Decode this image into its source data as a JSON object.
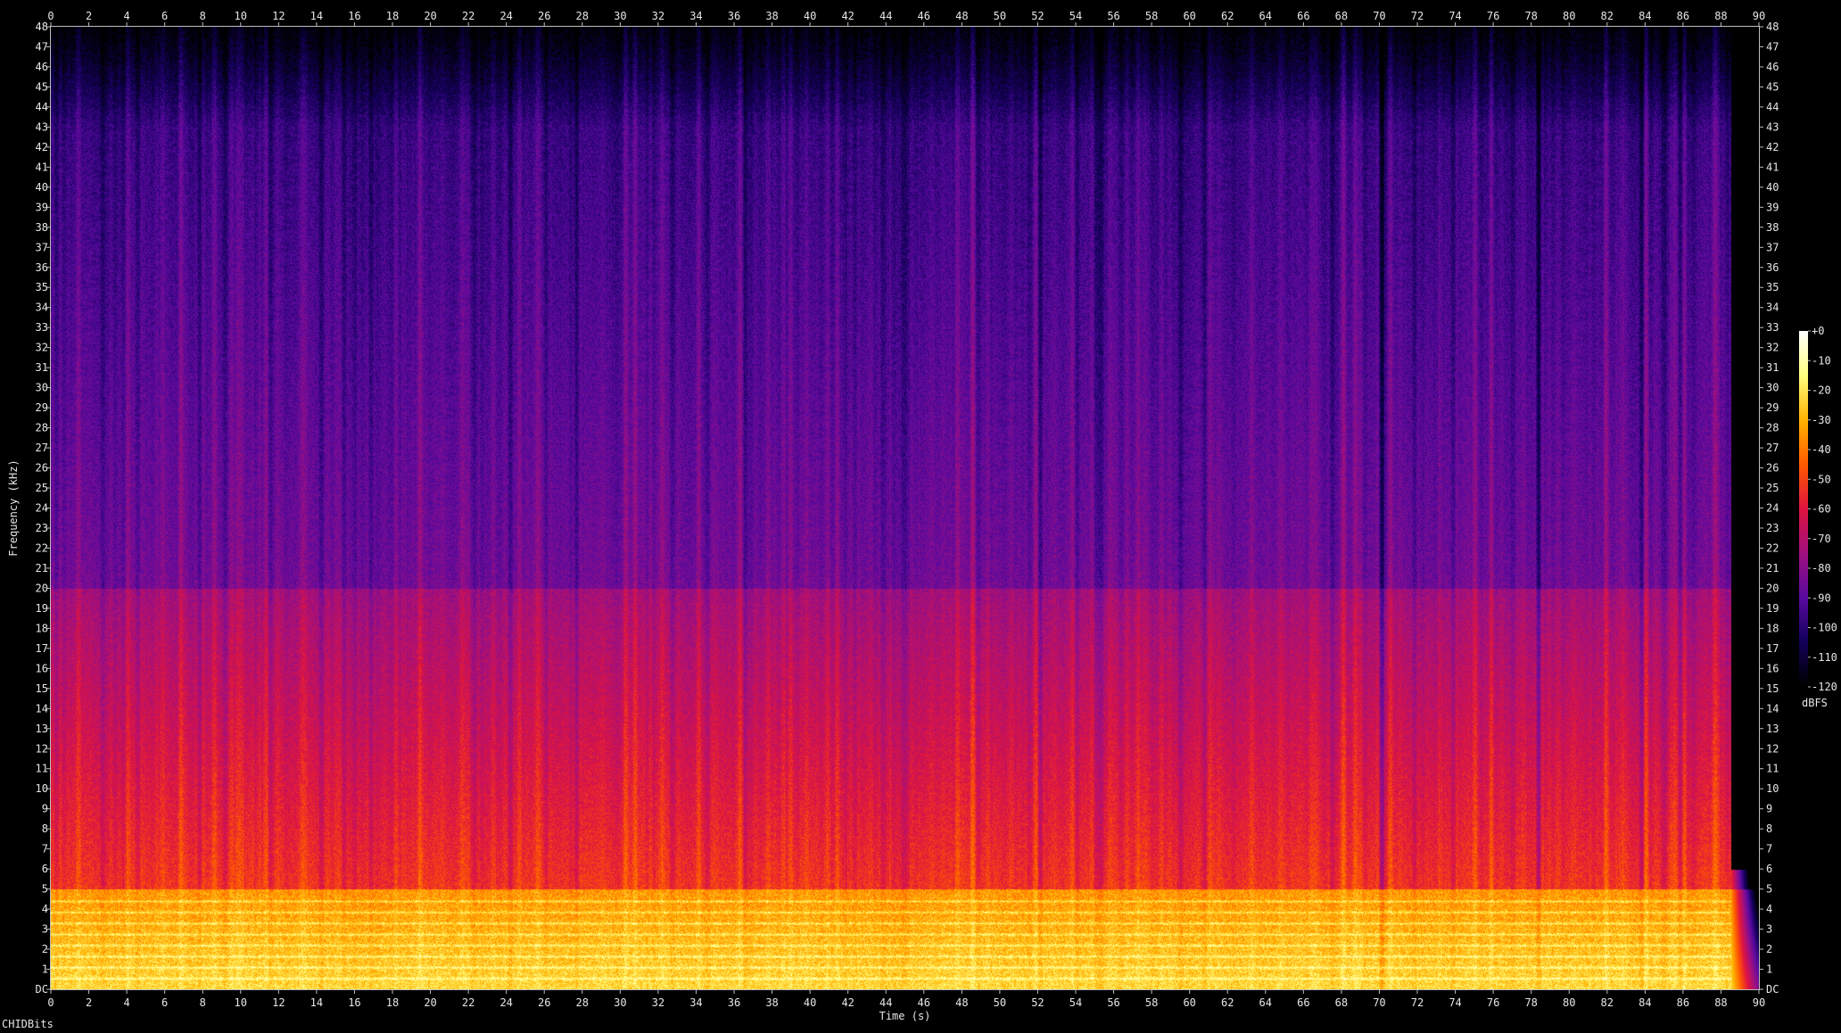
{
  "chart_data": {
    "type": "heatmap",
    "title": "",
    "xlabel": "Time (s)",
    "ylabel": "Frequency (kHz)",
    "xlim": [
      0,
      90
    ],
    "ylim": [
      0,
      48
    ],
    "x_ticks": [
      "0",
      "2",
      "4",
      "6",
      "8",
      "10",
      "12",
      "14",
      "16",
      "18",
      "20",
      "22",
      "24",
      "26",
      "28",
      "30",
      "32",
      "34",
      "36",
      "38",
      "40",
      "42",
      "44",
      "46",
      "48",
      "50",
      "52",
      "54",
      "56",
      "58",
      "60",
      "62",
      "64",
      "66",
      "68",
      "70",
      "72",
      "74",
      "76",
      "78",
      "80",
      "82",
      "84",
      "86",
      "88",
      "90"
    ],
    "y_ticks": [
      "DC",
      "1",
      "2",
      "3",
      "4",
      "5",
      "6",
      "7",
      "8",
      "9",
      "10",
      "11",
      "12",
      "13",
      "14",
      "15",
      "16",
      "17",
      "18",
      "19",
      "20",
      "21",
      "22",
      "23",
      "24",
      "25",
      "26",
      "27",
      "28",
      "29",
      "30",
      "31",
      "32",
      "33",
      "34",
      "35",
      "36",
      "37",
      "38",
      "39",
      "40",
      "41",
      "42",
      "43",
      "44",
      "45",
      "46",
      "47",
      "48"
    ],
    "colorbar": {
      "unit": "dBFS",
      "range": [
        -120,
        0
      ],
      "ticks": [
        "+0",
        "-10",
        "-20",
        "-30",
        "-40",
        "-50",
        "-60",
        "-70",
        "-80",
        "-90",
        "-100",
        "-110",
        "-120"
      ],
      "colors": [
        "#000000",
        "#12005a",
        "#5a0aa0",
        "#a0107f",
        "#e01440",
        "#ff5a00",
        "#ffb400",
        "#ffff80",
        "#ffffff"
      ]
    },
    "audio_end_s": 88.5,
    "description_levels_db": {
      "low_band_0_5kHz": -35,
      "mid_band_5_20kHz": -75,
      "high_band_20_48kHz": -100
    },
    "grid": false,
    "legend": "colorbar-right"
  },
  "footer": {
    "label": "CHIDBits"
  }
}
